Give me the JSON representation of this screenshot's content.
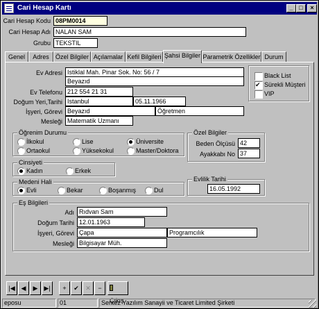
{
  "window": {
    "title": "Cari Hesap Kartı",
    "min_label": "_",
    "max_label": "□",
    "close_label": "×"
  },
  "header": {
    "kod_label": "Cari Hesap Kodu",
    "kod_value": "08PM0014",
    "adi_label": "Cari Hesap Adı",
    "adi_value": "NALAN SAM",
    "grubu_label": "Grubu",
    "grubu_value": "TEKSTIL"
  },
  "tabs": [
    {
      "label": "Genel"
    },
    {
      "label": "Adres"
    },
    {
      "label": "Özel Bilgiler"
    },
    {
      "label": "Açılamalar"
    },
    {
      "label": "Kefil Bilgileri"
    },
    {
      "label": "Şahsi Bilgiler"
    },
    {
      "label": "Parametrik Özellikler"
    },
    {
      "label": "Durum"
    }
  ],
  "form": {
    "ev_adresi_label": "Ev Adresi",
    "ev_adresi_1": "Istiklal Mah. Pinar Sok.   No: 56 / 7",
    "ev_adresi_2": "Beyazıd",
    "ev_telefonu_label": "Ev Telefonu",
    "ev_telefonu": "212 554 21 31",
    "dogum_label": "Doğum Yeri,Tarihi",
    "dogum_yeri": "Istanbul",
    "dogum_tarihi": "05.11.1966",
    "isyeri_label": "İşyeri, Görevi",
    "isyeri": "Beyazıd",
    "gorevi": "Öğretmen",
    "meslegi_label": "Mesleği",
    "meslegi": "Matematik Uzmanı"
  },
  "flags": {
    "black_list": "Black List",
    "black_list_checked": false,
    "surekli": "Sürekli Müşteri",
    "surekli_checked": true,
    "vip": "VIP",
    "vip_checked": false
  },
  "ogrenim": {
    "title": "Öğrenim Durumu",
    "options": [
      "İlkokul",
      "Lise",
      "Üniversite",
      "Ortaokul",
      "Yüksekokul",
      "Master/Doktora"
    ],
    "selected": "Üniversite"
  },
  "ozel": {
    "title": "Özel Bilgiler",
    "beden_label": "Beden Ölçüsü",
    "beden_value": "42",
    "ayakkabi_label": "Ayakkabı No",
    "ayakkabi_value": "37"
  },
  "cinsiyet": {
    "title": "Cinsiyeti",
    "options": [
      "Kadın",
      "Erkek"
    ],
    "selected": "Kadın"
  },
  "medeni": {
    "title": "Medeni Hali",
    "options": [
      "Evli",
      "Bekar",
      "Boşanmış",
      "Dul"
    ],
    "selected": "Evli"
  },
  "evlilik": {
    "title": "Evlilik Tarihi",
    "value": "16.05.1992"
  },
  "es": {
    "title": "Eş Bilgileri",
    "adi_label": "Adı",
    "adi": "Rıdvan Sam",
    "dogum_label": "Doğum Tarihi",
    "dogum": "12.01.1963",
    "isyeri_label": "İşyeri, Görevi",
    "isyeri": "Çapa",
    "gorevi": "Programcılık",
    "meslegi_label": "Mesleği",
    "meslegi": "Bilgisayar Müh."
  },
  "navigator": {
    "first": "|◀",
    "prior": "◀",
    "next": "▶",
    "last": "▶|",
    "insert": "+",
    "post": "✔",
    "cancel": "✕",
    "delete": "−",
    "exit": "Çıkış"
  },
  "statusbar": {
    "cell1": "eposu",
    "cell2": "01",
    "cell3": "Sentez Yazılım Sanayii ve Ticaret Limited Şirketi"
  }
}
